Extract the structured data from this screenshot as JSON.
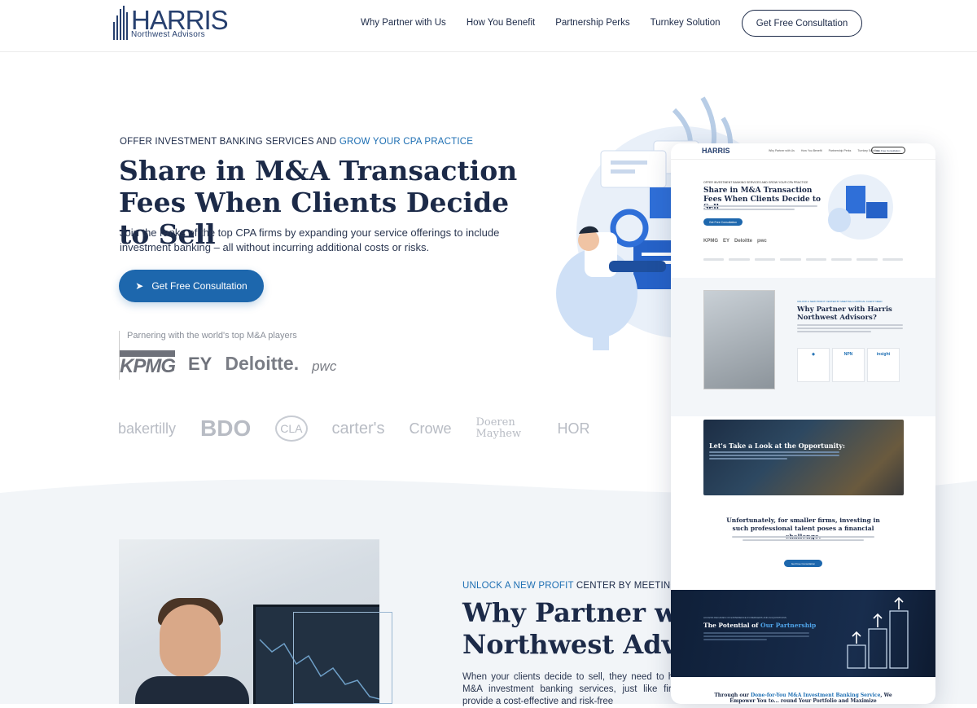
{
  "header": {
    "logo_word": "HARRIS",
    "logo_sub": "Northwest Advisors",
    "nav": [
      "Why Partner with Us",
      "How You Benefit",
      "Partnership Perks",
      "Turnkey Solution"
    ],
    "cta": "Get Free Consultation"
  },
  "hero": {
    "eyebrow_lead": "OFFER INVESTMENT BANKING SERVICES AND ",
    "eyebrow_accent": "GROW YOUR CPA PRACTICE",
    "title": "Share in M&A Transaction Fees When Clients Decide to Sell",
    "description": "Join the ranks of the top CPA firms by expanding your service offerings to include investment banking – all without incurring additional costs or risks.",
    "cta_icon": "➤",
    "cta": "Get Free Consultation",
    "partner_label": "Parnering with the world's top M&A players",
    "partner_logos": [
      "KPMG",
      "EY",
      "Deloitte.",
      "pwc"
    ],
    "client_logos": [
      "bakertilly",
      "BDO",
      "CLA",
      "carter's",
      "Crowe",
      "Doeren Mayhew",
      "HOR"
    ]
  },
  "section2": {
    "eyebrow_accent": "UNLOCK A NEW PROFIT",
    "eyebrow_rest": " CENTER BY MEETING A",
    "title_line1": "Why Partner with",
    "title_line2": "Northwest Adviso",
    "text": "When your clients decide to sell, they need to hire offer M&A investment banking services, just like firms. We provide a cost-effective and risk-free"
  },
  "mockup": {
    "logo": "HARRIS",
    "nav": [
      "Why Partner with Us",
      "How You Benefit",
      "Partnership Perks",
      "Turnkey Solution"
    ],
    "nav_cta": "Get Free Consultation",
    "eyebrow": "OFFER INVESTMENT BANKING SERVICES AND GROW YOUR CPA PRACTICE",
    "title": "Share in M&A Transaction Fees When Clients Decide to Sell",
    "cta": "Get Free Consultation",
    "partner_logos": [
      "KPMG",
      "EY",
      "Deloitte",
      "pwc"
    ],
    "s2_eyebrow": "UNLOCK A NEW PROFIT CENTER BY MEETING A CRITICAL CLIENT NEED",
    "s2_title": "Why Partner with Harris Northwest Advisors?",
    "cards": [
      "NPN",
      "insight"
    ],
    "dark_title": "Let's Take a Look at the Opportunity:",
    "unfortunately": "Unfortunately, for smaller firms, investing in such professional talent poses a financial challenge.",
    "unf_cta": "Get Free Consultation",
    "navy_eyebrow": "ACCESS DECADES OF EXPERIENCE IN MERGERS AND ACQUISITIONS",
    "navy_title_lead": "The Potential of ",
    "navy_title_accent": "Our Partnership",
    "bottom_lead": "Through our ",
    "bottom_accent": "Done-for-You M&A Investment Banking Service",
    "bottom_rest": ", We Empower You to... round Your Portfolio and Maximize Profitability!"
  },
  "colors": {
    "navy": "#1c2a48",
    "accent": "#1e6fb3",
    "button": "#1d67ad",
    "wave": "#f2f5f8"
  }
}
